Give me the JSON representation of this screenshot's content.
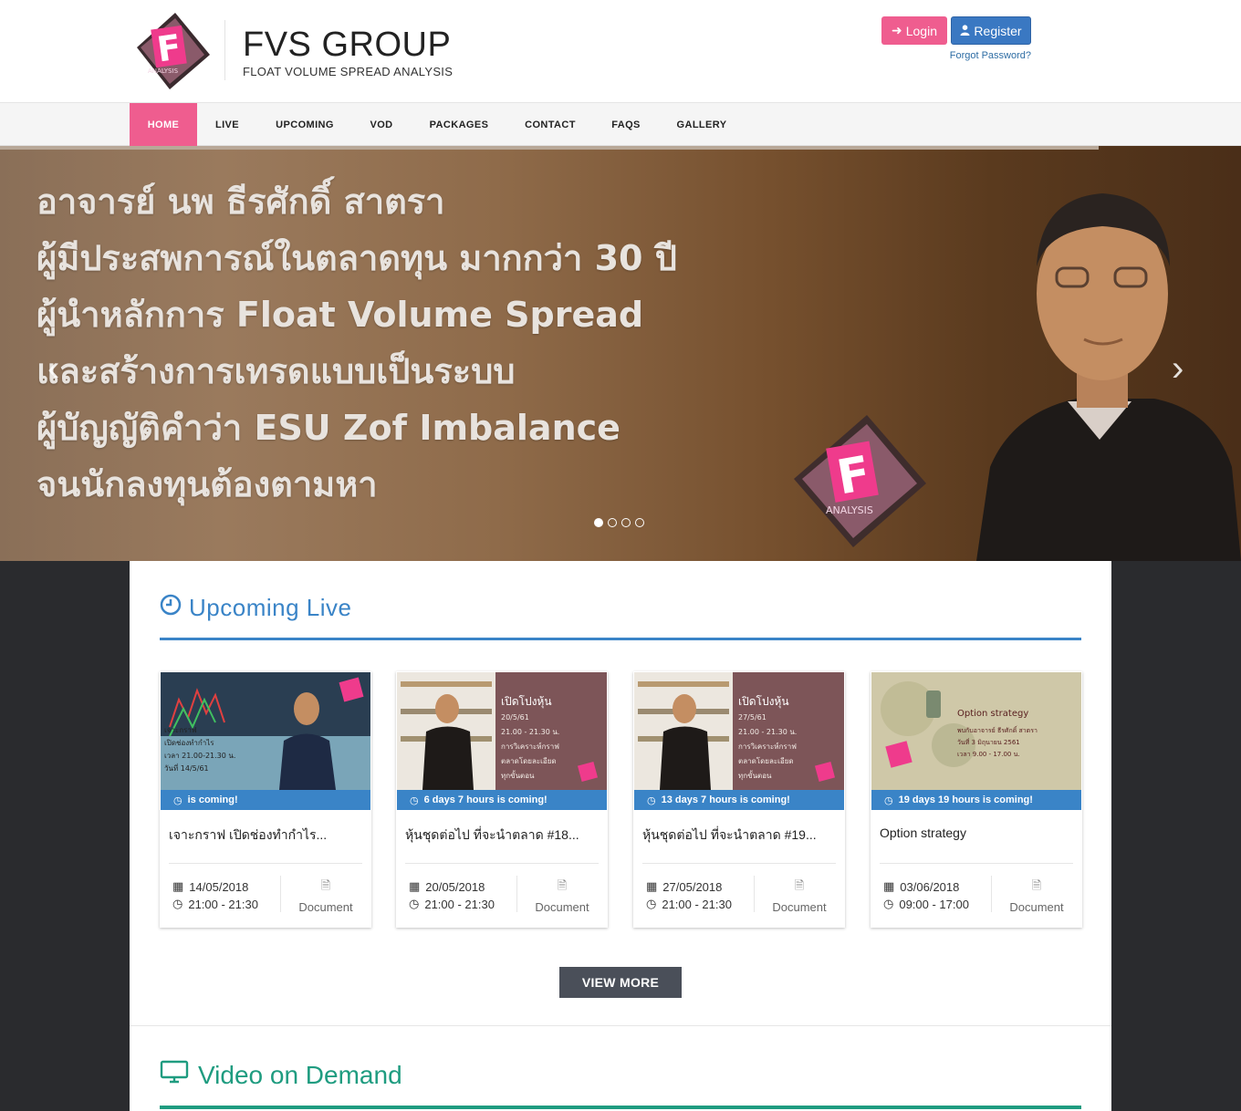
{
  "header": {
    "brand_title": "FVS GROUP",
    "brand_subtitle": "FLOAT VOLUME SPREAD ANALYSIS",
    "logo_text": "ANALYSIS",
    "login_label": "Login",
    "register_label": "Register",
    "forgot_label": "Forgot Password?"
  },
  "nav": {
    "items": [
      {
        "label": "HOME",
        "active": true
      },
      {
        "label": "LIVE"
      },
      {
        "label": "UPCOMING"
      },
      {
        "label": "VOD"
      },
      {
        "label": "PACKAGES"
      },
      {
        "label": "CONTACT"
      },
      {
        "label": "FAQS"
      },
      {
        "label": "GALLERY"
      }
    ]
  },
  "hero": {
    "lines": [
      "อาจารย์ นพ ธีรศักดิ์ สาตรา",
      "ผู้มีประสพการณ์ในตลาดทุน มากกว่า 30 ปี",
      "ผู้นำหลักการ Float Volume Spread",
      "และสร้างการเทรดแบบเป็นระบบ",
      "ผู้บัญญัติคำว่า ESU  Zof Imbalance",
      "จนนักลงทุนต้องตามหา"
    ],
    "prev": "‹",
    "next": "›",
    "slides": 4,
    "active_slide": 1,
    "logo_text": "ANALYSIS"
  },
  "upcoming": {
    "title": "Upcoming Live",
    "cards": [
      {
        "countdown": "is coming!",
        "title": "เจาะกราฟ เปิดช่องทำกำไร...",
        "date": "14/05/2018",
        "time": "21:00 - 21:30",
        "doc": "Document",
        "thumb_lines": [
          "เจาะกราฟ",
          "เปิดช่องทำกำไร",
          "เวลา 21.00-21.30 น.",
          "วันที่ 14/5/61"
        ]
      },
      {
        "countdown": "6 days 7 hours is coming!",
        "title": "หุ้นชุดต่อไป ที่จะนำตลาด #18...",
        "date": "20/05/2018",
        "time": "21:00 - 21:30",
        "doc": "Document",
        "thumb_lines": [
          "เปิดโปงหุ้น",
          "20/5/61",
          "21.00 - 21.30 น.",
          "การวิเคราะห์กราฟ",
          "ตลาดโดยละเอียด",
          "ทุกขั้นตอน"
        ]
      },
      {
        "countdown": "13 days 7 hours is coming!",
        "title": "หุ้นชุดต่อไป ที่จะนำตลาด #19...",
        "date": "27/05/2018",
        "time": "21:00 - 21:30",
        "doc": "Document",
        "thumb_lines": [
          "เปิดโปงหุ้น",
          "27/5/61",
          "21.00 - 21.30 น.",
          "การวิเคราะห์กราฟ",
          "ตลาดโดยละเอียด",
          "ทุกขั้นตอน"
        ]
      },
      {
        "countdown": "19 days 19 hours is coming!",
        "title": "Option strategy",
        "date": "03/06/2018",
        "time": "09:00 - 17:00",
        "doc": "Document",
        "thumb_lines": [
          "Option strategy",
          "พบกับอาจารย์ ธีรศักดิ์ สาตรา",
          "วันที่ 3 มิถุนายน 2561",
          "เวลา 9.00 - 17.00 น."
        ]
      }
    ],
    "view_more": "VIEW MORE"
  },
  "vod": {
    "title": "Video on Demand"
  },
  "colors": {
    "pink": "#ef5d8f",
    "blue": "#3a84c7",
    "teal": "#1f9c80",
    "dark": "#4a4f59"
  }
}
